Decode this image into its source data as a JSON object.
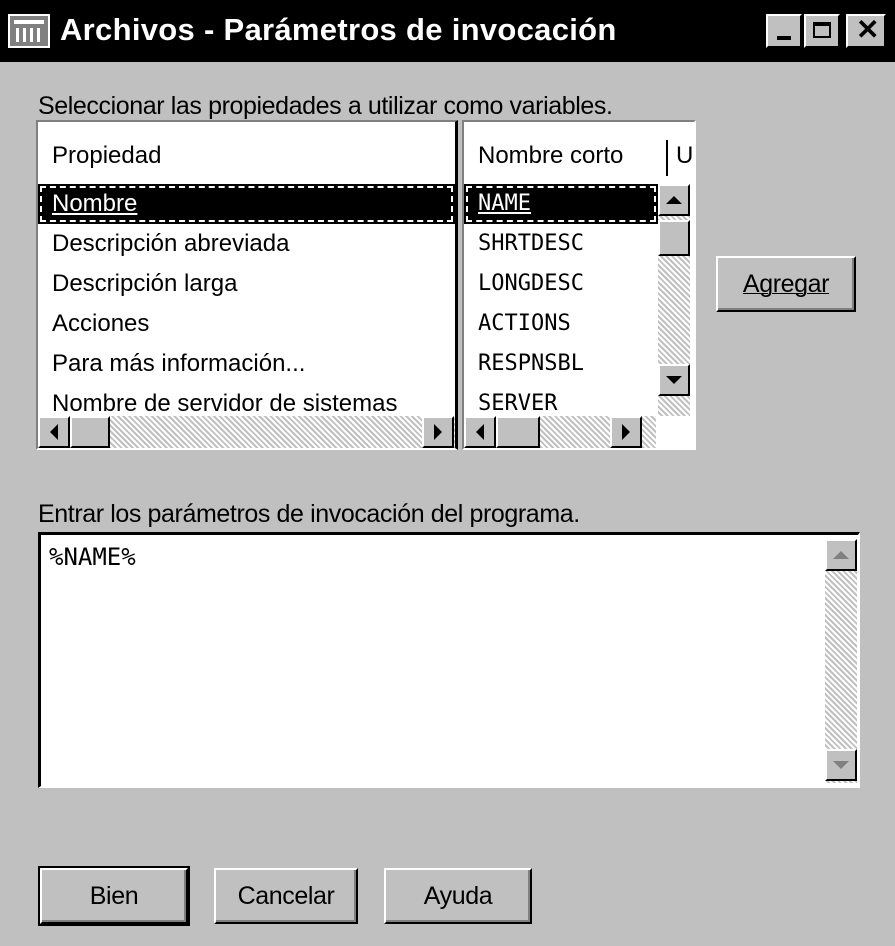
{
  "window": {
    "title": "Archivos - Parámetros de invocación"
  },
  "props_section": {
    "label": "Seleccionar las propiedades a utilizar como variables.",
    "columns": [
      "Propiedad",
      "Nombre corto",
      "U"
    ],
    "properties": [
      "Nombre",
      "Descripción abreviada",
      "Descripción larga",
      "Acciones",
      "Para más información...",
      "Nombre de servidor de sistemas"
    ],
    "short_names": [
      "NAME",
      "SHRTDESC",
      "LONGDESC",
      "ACTIONS",
      "RESPNSBL",
      "SERVER"
    ],
    "selected_index": 0
  },
  "add_button": {
    "label": "Agregar",
    "mnemonic": "A"
  },
  "params_section": {
    "label": "Entrar los parámetros de invocación del programa.",
    "value": "%NAME%"
  },
  "footer": {
    "ok_label": "Bien",
    "cancel_label": "Cancelar",
    "help_label": "Ayuda"
  }
}
